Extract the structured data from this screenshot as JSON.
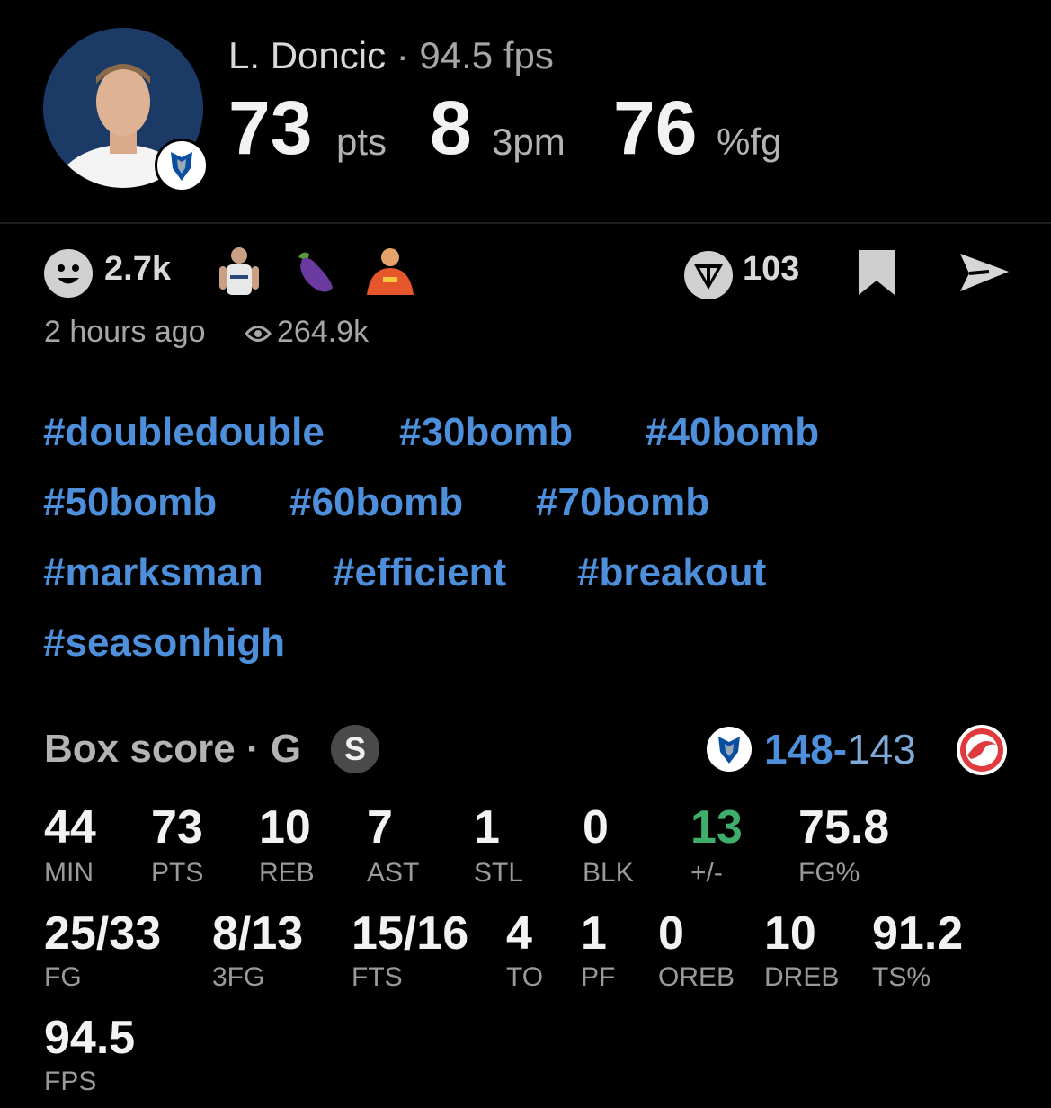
{
  "header": {
    "player_name": "L. Doncic",
    "separator": "·",
    "fps_text": "94.5 fps",
    "stats": [
      {
        "value": "73",
        "unit": "pts"
      },
      {
        "value": "8",
        "unit": "3pm"
      },
      {
        "value": "76",
        "unit": "%fg"
      }
    ]
  },
  "engagement": {
    "reaction_count": "2.7k",
    "reaction_emojis": [
      "player-sticker-icon",
      "eggplant-icon",
      "wrestler-sticker-icon"
    ],
    "comment_count": "103",
    "time_ago": "2 hours ago",
    "views": "264.9k"
  },
  "hashtags": [
    "#doubledouble",
    "#30bomb",
    "#40bomb",
    "#50bomb",
    "#60bomb",
    "#70bomb",
    "#marksman",
    "#efficient",
    "#breakout",
    "#seasonhigh"
  ],
  "box_score": {
    "title": "Box score · G",
    "badge": "S",
    "score_home": "148",
    "score_dash": "-",
    "score_away": "143",
    "colors": {
      "home_score": "#4d8fdb",
      "away_score": "#4d8fdb",
      "positive": "#3fae6a"
    },
    "row1": [
      {
        "value": "44",
        "label": "MIN"
      },
      {
        "value": "73",
        "label": "PTS"
      },
      {
        "value": "10",
        "label": "REB"
      },
      {
        "value": "7",
        "label": "AST"
      },
      {
        "value": "1",
        "label": "STL"
      },
      {
        "value": "0",
        "label": "BLK"
      },
      {
        "value": "13",
        "label": "+/-"
      },
      {
        "value": "75.8",
        "label": "FG%"
      }
    ],
    "row2": [
      {
        "value": "25/33",
        "label": "FG"
      },
      {
        "value": "8/13",
        "label": "3FG"
      },
      {
        "value": "15/16",
        "label": "FTS"
      },
      {
        "value": "4",
        "label": "TO"
      },
      {
        "value": "1",
        "label": "PF"
      },
      {
        "value": "0",
        "label": "OREB"
      },
      {
        "value": "10",
        "label": "DREB"
      },
      {
        "value": "91.2",
        "label": "TS%"
      }
    ],
    "row3": [
      {
        "value": "94.5",
        "label": "FPS"
      }
    ]
  },
  "icons": {
    "avatar": "player-avatar",
    "team_logo": "mavericks-logo-icon",
    "opponent_logo": "hawks-logo-icon",
    "reaction": "smiley-icon",
    "comments": "comment-badge-icon",
    "bookmark": "bookmark-icon",
    "share": "send-icon",
    "views": "eye-icon"
  }
}
